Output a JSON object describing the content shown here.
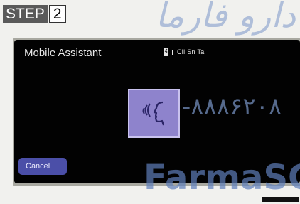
{
  "step": {
    "word": "STEP",
    "number": "2"
  },
  "watermarks": {
    "top_text": "دارو فارما",
    "phone": "-۸۸۸۶۲۰۸",
    "brand": "FarmaSC"
  },
  "screen": {
    "title": "Mobile Assistant",
    "status_text": "Cll Sn Tal",
    "voice_button_icon": "voice-command-icon",
    "cancel_label": "Cancel"
  },
  "colors": {
    "accent_purple": "#8e83cc",
    "cancel_blue": "#4b4fa8",
    "screen_bg": "#020202"
  }
}
